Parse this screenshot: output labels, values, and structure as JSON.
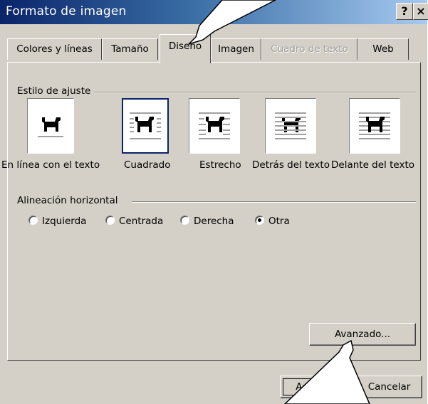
{
  "window": {
    "title": "Formato de imagen",
    "help_label": "?",
    "close_label": "×"
  },
  "tabs": [
    {
      "label": "Colores y líneas",
      "state": "normal"
    },
    {
      "label": "Tamaño",
      "state": "normal"
    },
    {
      "label": "Diseño",
      "state": "active"
    },
    {
      "label": "Imagen",
      "state": "normal"
    },
    {
      "label": "Cuadro de texto",
      "state": "disabled"
    },
    {
      "label": "Web",
      "state": "normal"
    }
  ],
  "wrap_style": {
    "group_label": "Estilo de ajuste",
    "options": [
      {
        "label": "En línea con el texto",
        "icon": "dog-inline-icon"
      },
      {
        "label": "Cuadrado",
        "icon": "dog-square-icon",
        "selected": true
      },
      {
        "label": "Estrecho",
        "icon": "dog-tight-icon"
      },
      {
        "label": "Detrás del texto",
        "icon": "dog-behind-text-icon"
      },
      {
        "label": "Delante del texto",
        "icon": "dog-in-front-text-icon"
      }
    ]
  },
  "alignment": {
    "group_label": "Alineación horizontal",
    "options": [
      {
        "label": "Izquierda",
        "checked": false
      },
      {
        "label": "Centrada",
        "checked": false
      },
      {
        "label": "Derecha",
        "checked": false
      },
      {
        "label": "Otra",
        "checked": true
      }
    ]
  },
  "buttons": {
    "advanced": "Avanzado...",
    "accept": "Aceptar",
    "cancel": "Cancelar"
  },
  "colors": {
    "face": "#d4d0c8",
    "title_start": "#0a246a",
    "title_end": "#a6caf0",
    "selection": "#0a246a"
  }
}
